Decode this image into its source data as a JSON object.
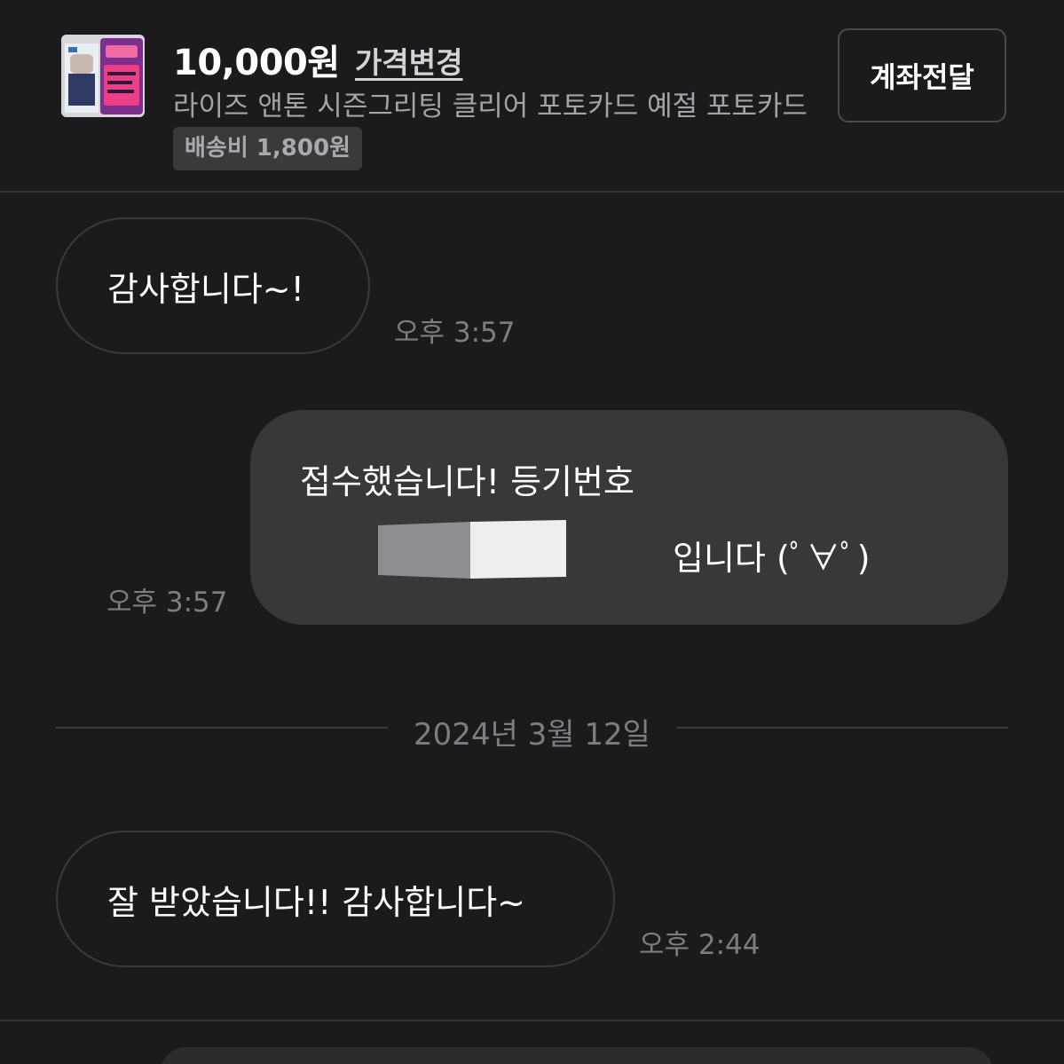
{
  "product": {
    "price": "10,000원",
    "price_change_label": "가격변경",
    "title": "라이즈 앤톤 시즌그리팅 클리어 포토카드 예절 포토카드",
    "shipping": "배송비 1,800원",
    "transfer_button_label": "계좌전달"
  },
  "messages": [
    {
      "direction": "incoming",
      "text": "감사합니다~!",
      "time": "오후 3:57"
    },
    {
      "direction": "outgoing",
      "line1": "접수했습니다! 등기번호",
      "line2_suffix": "입니다 (ﾟ∀ﾟ)",
      "time": "오후 3:57"
    },
    {
      "direction": "incoming",
      "text": "잘 받았습니다!! 감사합니다~",
      "time": "오후 2:44"
    }
  ],
  "date_separator": "2024년 3월 12일",
  "colors": {
    "background": "#1b1b1d",
    "outgoing_bubble": "#38383b",
    "incoming_border": "#3a3a3d",
    "muted_text": "#7d7d82"
  }
}
